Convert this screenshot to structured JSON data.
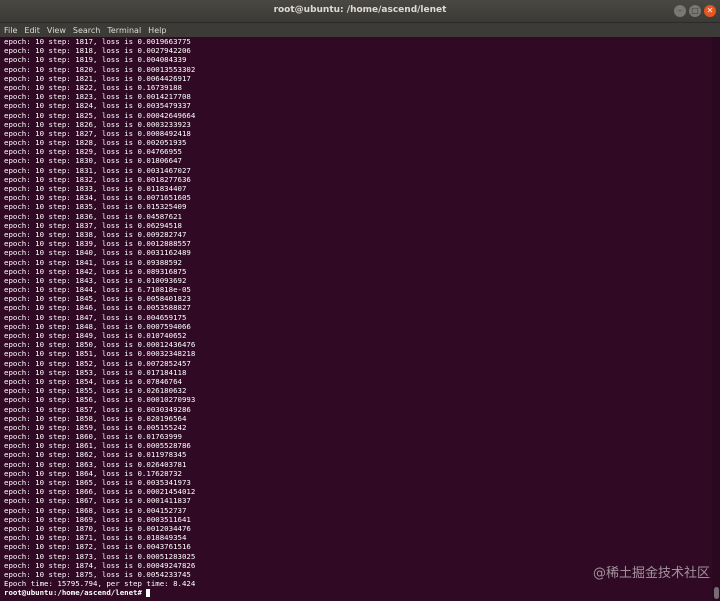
{
  "window": {
    "title": "root@ubuntu: /home/ascend/lenet",
    "buttons": [
      "–",
      "□",
      "✕"
    ]
  },
  "menu": [
    "File",
    "Edit",
    "View",
    "Search",
    "Terminal",
    "Help"
  ],
  "terminal": {
    "lines": [
      "epoch: 10 step: 1817, loss is 0.0019663775",
      "epoch: 10 step: 1818, loss is 0.0027942206",
      "epoch: 10 step: 1819, loss is 0.004084339",
      "epoch: 10 step: 1820, loss is 0.00013553302",
      "epoch: 10 step: 1821, loss is 0.0064426917",
      "epoch: 10 step: 1822, loss is 0.16739188",
      "epoch: 10 step: 1823, loss is 0.0014217708",
      "epoch: 10 step: 1824, loss is 0.0035479337",
      "epoch: 10 step: 1825, loss is 0.00042649664",
      "epoch: 10 step: 1826, loss is 0.0003233923",
      "epoch: 10 step: 1827, loss is 0.0008492418",
      "epoch: 10 step: 1828, loss is 0.002051935",
      "epoch: 10 step: 1829, loss is 0.04766955",
      "epoch: 10 step: 1830, loss is 0.01806647",
      "epoch: 10 step: 1831, loss is 0.0031467027",
      "epoch: 10 step: 1832, loss is 0.0018277636",
      "epoch: 10 step: 1833, loss is 0.011834407",
      "epoch: 10 step: 1834, loss is 0.0071651605",
      "epoch: 10 step: 1835, loss is 0.015325409",
      "epoch: 10 step: 1836, loss is 0.04587621",
      "epoch: 10 step: 1837, loss is 0.06294518",
      "epoch: 10 step: 1838, loss is 0.009282747",
      "epoch: 10 step: 1839, loss is 0.0012888557",
      "epoch: 10 step: 1840, loss is 0.0031162489",
      "epoch: 10 step: 1841, loss is 0.09388592",
      "epoch: 10 step: 1842, loss is 0.089316875",
      "epoch: 10 step: 1843, loss is 0.010093692",
      "epoch: 10 step: 1844, loss is 6.710818e-05",
      "epoch: 10 step: 1845, loss is 0.0058401823",
      "epoch: 10 step: 1846, loss is 0.0053588827",
      "epoch: 10 step: 1847, loss is 0.004659175",
      "epoch: 10 step: 1848, loss is 0.0007594066",
      "epoch: 10 step: 1849, loss is 0.010740652",
      "epoch: 10 step: 1850, loss is 0.00012436476",
      "epoch: 10 step: 1851, loss is 0.00032348218",
      "epoch: 10 step: 1852, loss is 0.0072852457",
      "epoch: 10 step: 1853, loss is 0.017184118",
      "epoch: 10 step: 1854, loss is 0.07846764",
      "epoch: 10 step: 1855, loss is 0.026180632",
      "epoch: 10 step: 1856, loss is 0.00010270993",
      "epoch: 10 step: 1857, loss is 0.0030349286",
      "epoch: 10 step: 1858, loss is 0.020196564",
      "epoch: 10 step: 1859, loss is 0.005155242",
      "epoch: 10 step: 1860, loss is 0.01763999",
      "epoch: 10 step: 1861, loss is 0.0005528786",
      "epoch: 10 step: 1862, loss is 0.011978345",
      "epoch: 10 step: 1863, loss is 0.026403781",
      "epoch: 10 step: 1864, loss is 0.17628732",
      "epoch: 10 step: 1865, loss is 0.0035341973",
      "epoch: 10 step: 1866, loss is 0.00021454012",
      "epoch: 10 step: 1867, loss is 0.0001411837",
      "epoch: 10 step: 1868, loss is 0.004152737",
      "epoch: 10 step: 1869, loss is 0.0003511641",
      "epoch: 10 step: 1870, loss is 0.0012034476",
      "epoch: 10 step: 1871, loss is 0.018849354",
      "epoch: 10 step: 1872, loss is 0.0043761516",
      "epoch: 10 step: 1873, loss is 0.00051283025",
      "epoch: 10 step: 1874, loss is 0.00049247826",
      "epoch: 10 step: 1875, loss is 0.0054233745",
      "Epoch time: 15795.794, per step time: 8.424"
    ],
    "prompt": "root@ubuntu:/home/ascend/lenet# "
  },
  "watermark": "@稀土掘金技术社区",
  "colors": {
    "terminal_bg": "#300a24",
    "titlebar_bg": "#3c3b37",
    "close_button": "#e95420",
    "text": "#ffffff"
  }
}
